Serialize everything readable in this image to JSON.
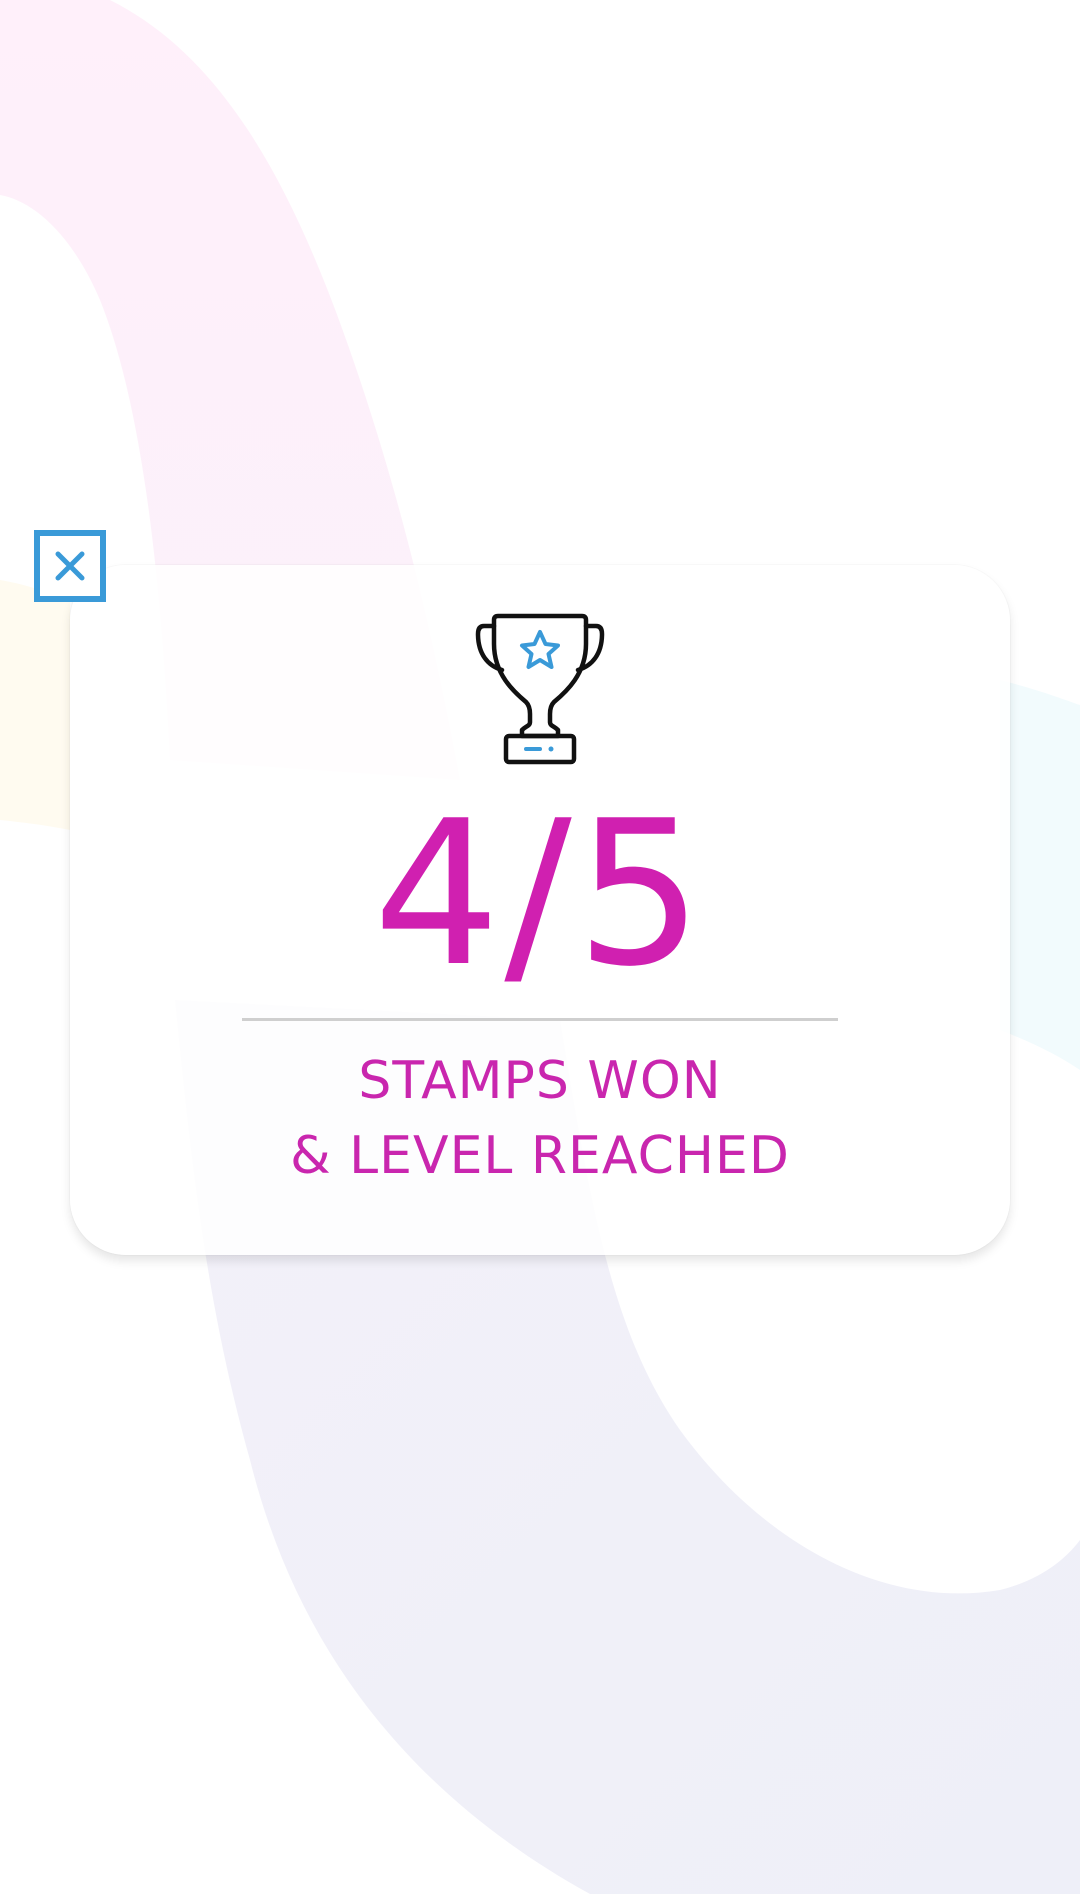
{
  "dialog": {
    "close_icon": "close-icon",
    "trophy_icon": "trophy-star-icon",
    "score_text": "4/5",
    "caption_line1": "STAMPS WON",
    "caption_line2": "& LEVEL REACHED"
  },
  "colors": {
    "accent_magenta": "#d020b0",
    "icon_blue": "#3a9ad8",
    "divider_gray": "#cfcfcf"
  }
}
